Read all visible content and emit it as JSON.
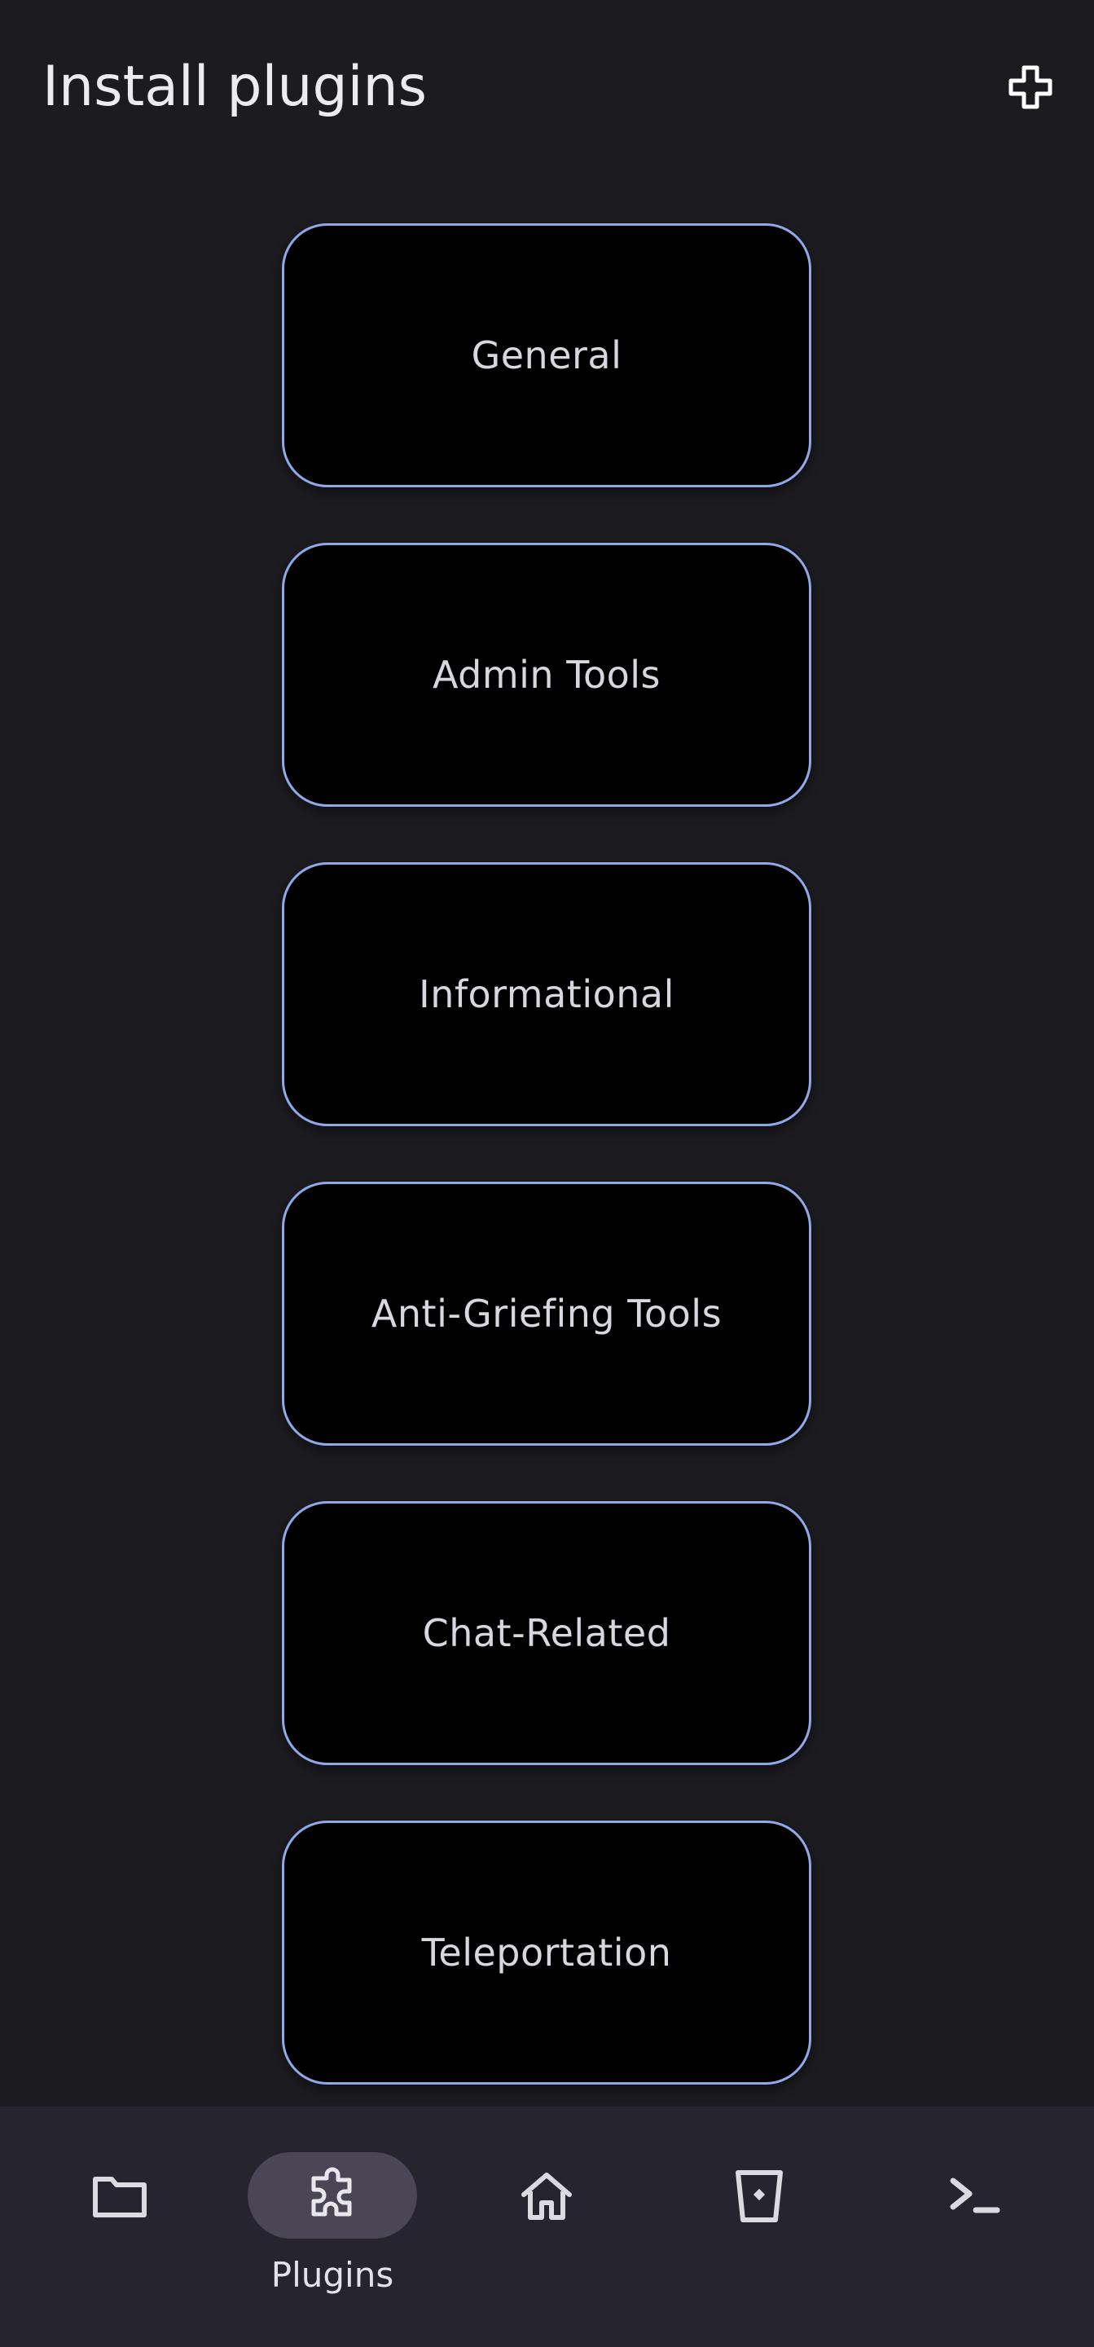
{
  "header": {
    "title": "Install plugins",
    "add_icon": "plus-icon"
  },
  "categories": [
    {
      "label": "General"
    },
    {
      "label": "Admin Tools"
    },
    {
      "label": "Informational"
    },
    {
      "label": "Anti-Griefing Tools"
    },
    {
      "label": "Chat-Related"
    },
    {
      "label": "Teleportation"
    }
  ],
  "bottom_nav": {
    "items": [
      {
        "icon": "folder-icon",
        "label": "",
        "active": false
      },
      {
        "icon": "puzzle-icon",
        "label": "Plugins",
        "active": true
      },
      {
        "icon": "home-icon",
        "label": "",
        "active": false
      },
      {
        "icon": "trash-icon",
        "label": "",
        "active": false
      },
      {
        "icon": "terminal-icon",
        "label": "",
        "active": false
      }
    ]
  },
  "colors": {
    "background": "#1c1b20",
    "card_background": "#000000",
    "card_border": "#8fa9e8",
    "nav_background": "#25242f",
    "nav_active_pill": "#4a4656"
  }
}
